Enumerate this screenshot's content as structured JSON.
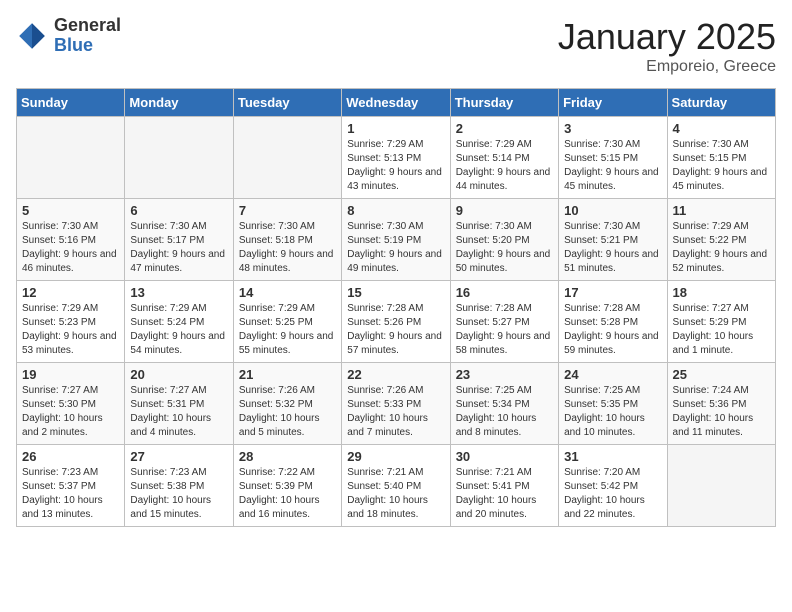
{
  "header": {
    "logo_general": "General",
    "logo_blue": "Blue",
    "title": "January 2025",
    "subtitle": "Emporeio, Greece"
  },
  "days_of_week": [
    "Sunday",
    "Monday",
    "Tuesday",
    "Wednesday",
    "Thursday",
    "Friday",
    "Saturday"
  ],
  "weeks": [
    [
      {
        "num": "",
        "empty": true
      },
      {
        "num": "",
        "empty": true
      },
      {
        "num": "",
        "empty": true
      },
      {
        "num": "1",
        "sunrise": "7:29 AM",
        "sunset": "5:13 PM",
        "daylight": "9 hours and 43 minutes."
      },
      {
        "num": "2",
        "sunrise": "7:29 AM",
        "sunset": "5:14 PM",
        "daylight": "9 hours and 44 minutes."
      },
      {
        "num": "3",
        "sunrise": "7:30 AM",
        "sunset": "5:15 PM",
        "daylight": "9 hours and 45 minutes."
      },
      {
        "num": "4",
        "sunrise": "7:30 AM",
        "sunset": "5:15 PM",
        "daylight": "9 hours and 45 minutes."
      }
    ],
    [
      {
        "num": "5",
        "sunrise": "7:30 AM",
        "sunset": "5:16 PM",
        "daylight": "9 hours and 46 minutes."
      },
      {
        "num": "6",
        "sunrise": "7:30 AM",
        "sunset": "5:17 PM",
        "daylight": "9 hours and 47 minutes."
      },
      {
        "num": "7",
        "sunrise": "7:30 AM",
        "sunset": "5:18 PM",
        "daylight": "9 hours and 48 minutes."
      },
      {
        "num": "8",
        "sunrise": "7:30 AM",
        "sunset": "5:19 PM",
        "daylight": "9 hours and 49 minutes."
      },
      {
        "num": "9",
        "sunrise": "7:30 AM",
        "sunset": "5:20 PM",
        "daylight": "9 hours and 50 minutes."
      },
      {
        "num": "10",
        "sunrise": "7:30 AM",
        "sunset": "5:21 PM",
        "daylight": "9 hours and 51 minutes."
      },
      {
        "num": "11",
        "sunrise": "7:29 AM",
        "sunset": "5:22 PM",
        "daylight": "9 hours and 52 minutes."
      }
    ],
    [
      {
        "num": "12",
        "sunrise": "7:29 AM",
        "sunset": "5:23 PM",
        "daylight": "9 hours and 53 minutes."
      },
      {
        "num": "13",
        "sunrise": "7:29 AM",
        "sunset": "5:24 PM",
        "daylight": "9 hours and 54 minutes."
      },
      {
        "num": "14",
        "sunrise": "7:29 AM",
        "sunset": "5:25 PM",
        "daylight": "9 hours and 55 minutes."
      },
      {
        "num": "15",
        "sunrise": "7:28 AM",
        "sunset": "5:26 PM",
        "daylight": "9 hours and 57 minutes."
      },
      {
        "num": "16",
        "sunrise": "7:28 AM",
        "sunset": "5:27 PM",
        "daylight": "9 hours and 58 minutes."
      },
      {
        "num": "17",
        "sunrise": "7:28 AM",
        "sunset": "5:28 PM",
        "daylight": "9 hours and 59 minutes."
      },
      {
        "num": "18",
        "sunrise": "7:27 AM",
        "sunset": "5:29 PM",
        "daylight": "10 hours and 1 minute."
      }
    ],
    [
      {
        "num": "19",
        "sunrise": "7:27 AM",
        "sunset": "5:30 PM",
        "daylight": "10 hours and 2 minutes."
      },
      {
        "num": "20",
        "sunrise": "7:27 AM",
        "sunset": "5:31 PM",
        "daylight": "10 hours and 4 minutes."
      },
      {
        "num": "21",
        "sunrise": "7:26 AM",
        "sunset": "5:32 PM",
        "daylight": "10 hours and 5 minutes."
      },
      {
        "num": "22",
        "sunrise": "7:26 AM",
        "sunset": "5:33 PM",
        "daylight": "10 hours and 7 minutes."
      },
      {
        "num": "23",
        "sunrise": "7:25 AM",
        "sunset": "5:34 PM",
        "daylight": "10 hours and 8 minutes."
      },
      {
        "num": "24",
        "sunrise": "7:25 AM",
        "sunset": "5:35 PM",
        "daylight": "10 hours and 10 minutes."
      },
      {
        "num": "25",
        "sunrise": "7:24 AM",
        "sunset": "5:36 PM",
        "daylight": "10 hours and 11 minutes."
      }
    ],
    [
      {
        "num": "26",
        "sunrise": "7:23 AM",
        "sunset": "5:37 PM",
        "daylight": "10 hours and 13 minutes."
      },
      {
        "num": "27",
        "sunrise": "7:23 AM",
        "sunset": "5:38 PM",
        "daylight": "10 hours and 15 minutes."
      },
      {
        "num": "28",
        "sunrise": "7:22 AM",
        "sunset": "5:39 PM",
        "daylight": "10 hours and 16 minutes."
      },
      {
        "num": "29",
        "sunrise": "7:21 AM",
        "sunset": "5:40 PM",
        "daylight": "10 hours and 18 minutes."
      },
      {
        "num": "30",
        "sunrise": "7:21 AM",
        "sunset": "5:41 PM",
        "daylight": "10 hours and 20 minutes."
      },
      {
        "num": "31",
        "sunrise": "7:20 AM",
        "sunset": "5:42 PM",
        "daylight": "10 hours and 22 minutes."
      },
      {
        "num": "",
        "empty": true
      }
    ]
  ]
}
